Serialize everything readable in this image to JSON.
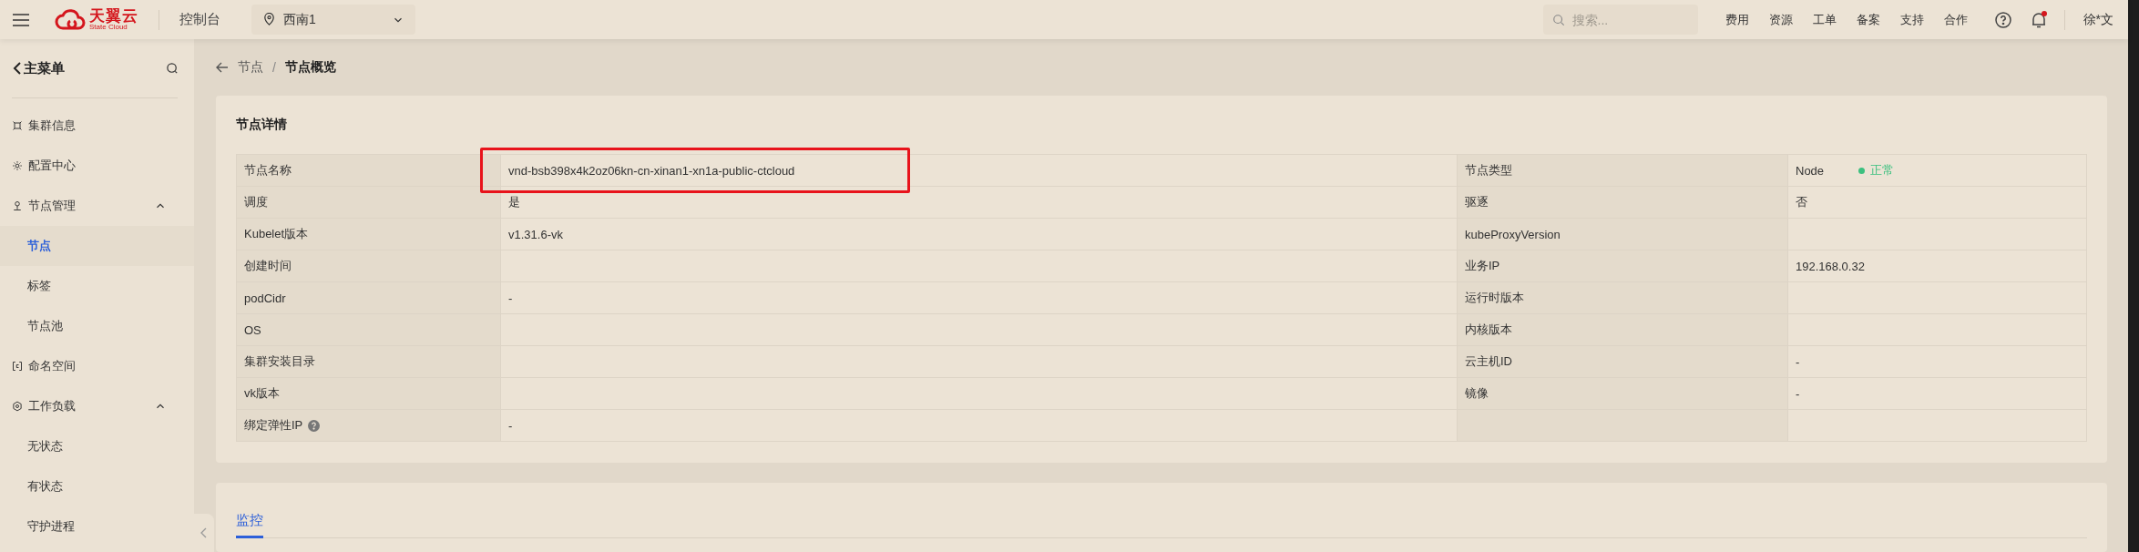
{
  "header": {
    "logo": {
      "name": "天翼云",
      "sub": "State Cloud"
    },
    "console": "控制台",
    "region": "西南1",
    "search": {
      "placeholder": "搜索..."
    },
    "links": [
      "费用",
      "资源",
      "工单",
      "备案",
      "支持",
      "合作"
    ],
    "notification_dot": true,
    "user": "徐*文"
  },
  "sidebar": {
    "title": "主菜单",
    "items": [
      {
        "label": "集群信息",
        "selected": false
      },
      {
        "label": "配置中心",
        "selected": false
      },
      {
        "label": "节点管理",
        "selected": false,
        "expanded": true,
        "children": [
          {
            "label": "节点",
            "selected": true
          },
          {
            "label": "标签",
            "selected": false
          },
          {
            "label": "节点池",
            "selected": false
          }
        ]
      },
      {
        "label": "命名空间",
        "selected": false
      },
      {
        "label": "工作负载",
        "selected": false,
        "expanded": true,
        "children": [
          {
            "label": "无状态",
            "selected": false
          },
          {
            "label": "有状态",
            "selected": false
          },
          {
            "label": "守护进程",
            "selected": false
          }
        ]
      }
    ]
  },
  "breadcrumb": [
    "节点",
    "节点概览"
  ],
  "breadcrumb_separator": "/",
  "details": {
    "title": "节点详情",
    "rows": [
      {
        "cells": [
          {
            "label": "节点名称",
            "value": "vnd-bsb398x4k2oz06kn-cn-xinan1-xn1a-public-ctcloud",
            "highlighted": true
          },
          {
            "label": "节点类型",
            "value": "Node",
            "status": {
              "label": "正常",
              "color": "#3cc07f"
            }
          }
        ]
      },
      {
        "cells": [
          {
            "label": "调度",
            "value": "是"
          },
          {
            "label": "驱逐",
            "value": "否"
          }
        ]
      },
      {
        "cells": [
          {
            "label": "Kubelet版本",
            "value": "v1.31.6-vk"
          },
          {
            "label": "kubeProxyVersion"
          }
        ]
      },
      {
        "cells": [
          {
            "label": "创建时间"
          },
          {
            "label": "业务IP",
            "value": "192.168.0.32"
          }
        ]
      },
      {
        "cells": [
          {
            "label": "podCidr",
            "value": "-"
          },
          {
            "label": "运行时版本"
          }
        ]
      },
      {
        "cells": [
          {
            "label": "OS"
          },
          {
            "label": "内核版本"
          }
        ]
      },
      {
        "cells": [
          {
            "label": "集群安装目录"
          },
          {
            "label": "云主机ID",
            "value": "-"
          }
        ]
      },
      {
        "cells": [
          {
            "label": "vk版本"
          },
          {
            "label": "镜像",
            "value": "-"
          }
        ]
      },
      {
        "cells": [
          {
            "label": "绑定弹性IP",
            "help": true,
            "value": "-"
          },
          {}
        ]
      }
    ]
  },
  "monitor_tabs": [
    {
      "label": "监控",
      "selected": true
    }
  ]
}
